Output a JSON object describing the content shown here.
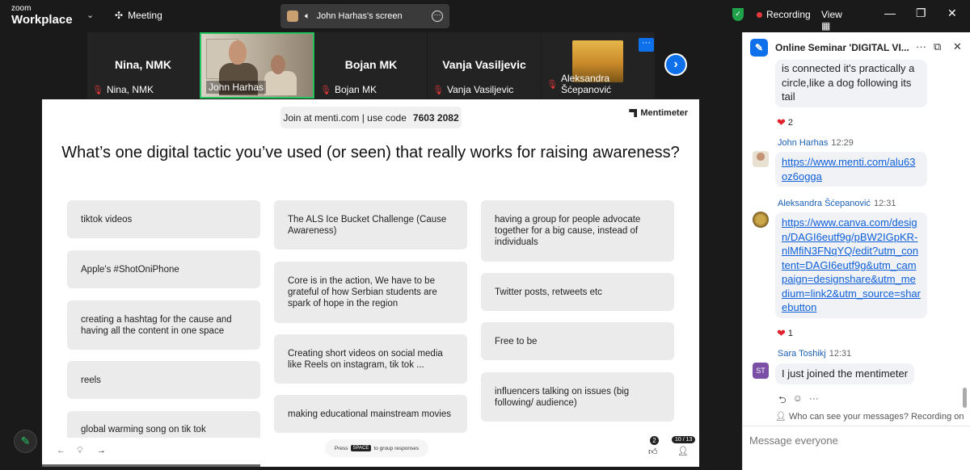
{
  "topbar": {
    "brand_small": "zoom",
    "brand_large": "Workplace",
    "meeting_label": "Meeting",
    "screen_share_label": "John Harhas's screen",
    "recording_label": "Recording",
    "view_label": "View"
  },
  "participants": [
    {
      "name": "Nina, NMK",
      "label": "Nina, NMK"
    },
    {
      "name": "",
      "label": "John Harhas"
    },
    {
      "name": "Bojan  MK",
      "label": "Bojan  MK"
    },
    {
      "name": "Vanja Vasiljevic",
      "label": "Vanja Vasiljevic"
    },
    {
      "name": "",
      "label": "Aleksandra Šćepanović"
    }
  ],
  "presentation": {
    "join_text": "Join at menti.com | use code",
    "code": "7603 2082",
    "brand": "Mentimeter",
    "question": "What’s one digital tactic you’ve used (or seen) that really works for raising awareness?",
    "responses": [
      "tiktok videos",
      "Apple's #ShotOniPhone",
      "creating a hashtag for the cause and having all the content in one space",
      "reels",
      "global warming song on tik tok",
      "The ALS Ice Bucket Challenge (Cause Awareness)",
      "Core is in the action, We have to be grateful of how Serbian students are spark of hope in the region",
      "Creating short videos on social media like Reels on instagram, tik tok ...",
      "making educational mainstream movies",
      "having a group for people advocate together for a big cause, instead of individuals",
      "Twitter posts, retweets etc",
      "Free to be",
      "influencers talking on issues (big following/ audience)"
    ],
    "footer": {
      "press": "Press",
      "key": "SPACE",
      "hint": "to group responses",
      "reaction_count": "2",
      "pager": "10 / 13"
    }
  },
  "chat": {
    "title": "Online Seminar 'DIGITAL VI...",
    "partial_message": "is connected it's practically a circle,like a dog following its tail",
    "partial_reaction_count": "2",
    "messages": [
      {
        "sender": "John Harhas",
        "time": "12:29",
        "text": "https://www.menti.com/alu63oz6ogga"
      },
      {
        "sender": "Aleksandra Šćepanović",
        "time": "12:31",
        "text": "https://www.canva.com/design/DAGI6eutf9g/pBW2IGpKR-nlMfiN3FNqYQ/edit?utm_content=DAGI6eutf9g&utm_campaign=designshare&utm_medium=link2&utm_source=sharebutton",
        "reaction_count": "1"
      },
      {
        "sender": "Sara Toshikj",
        "time": "12:31",
        "initials": "ST",
        "text": "I just joined the mentimeter"
      }
    ],
    "privacy_text": "Who can see your messages? Recording on",
    "input_placeholder": "Message everyone"
  },
  "colors": {
    "accent": "#0e71eb",
    "active_speaker": "#22c55e",
    "recording": "#e5383b",
    "shield": "#1fa24a"
  }
}
